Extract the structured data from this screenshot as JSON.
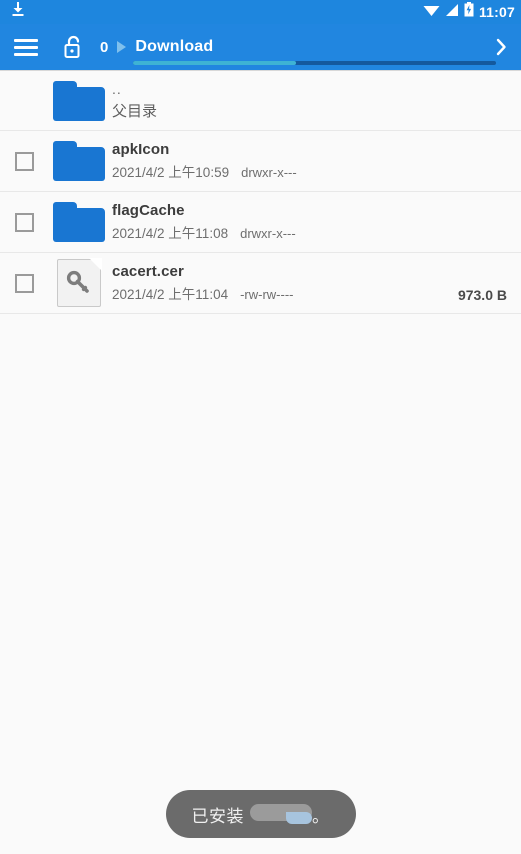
{
  "status_bar": {
    "download_icon": "download-icon",
    "wifi_icon": "wifi-icon",
    "signal_icon": "signal-icon",
    "battery_icon": "battery-charging-icon",
    "clock": "11:07",
    "background_color": "#1E86DE"
  },
  "app_bar": {
    "menu_icon": "hamburger-menu-icon",
    "lock_icon": "unlocked-padlock-icon",
    "breadcrumb_count": "0",
    "breadcrumb_separator_icon": "triangle-right-icon",
    "breadcrumb_label": "Download",
    "overflow_icon": "chevron-right-icon",
    "background_color": "#2186E0",
    "progress_percent": 45,
    "progress_fill_color": "#3EB3D4",
    "progress_track_color": "#14599E"
  },
  "file_list": {
    "rows": [
      {
        "name": "..",
        "subtitle": "父目录",
        "icon": "folder-icon",
        "has_checkbox": false,
        "date": "",
        "permissions": "",
        "size": ""
      },
      {
        "name": "apkIcon",
        "subtitle": "",
        "icon": "folder-icon",
        "has_checkbox": true,
        "date": "2021/4/2 上午10:59",
        "permissions": "drwxr-x---",
        "size": ""
      },
      {
        "name": "flagCache",
        "subtitle": "",
        "icon": "folder-icon",
        "has_checkbox": true,
        "date": "2021/4/2 上午11:08",
        "permissions": "drwxr-x---",
        "size": ""
      },
      {
        "name": "cacert.cer",
        "subtitle": "",
        "icon": "certificate-file-icon",
        "has_checkbox": true,
        "date": "2021/4/2 上午11:04",
        "permissions": "-rw-rw----",
        "size": "973.0 B"
      }
    ]
  },
  "toast": {
    "message": "已安装",
    "suffix": "。",
    "background_color": "#6B6B6B"
  }
}
